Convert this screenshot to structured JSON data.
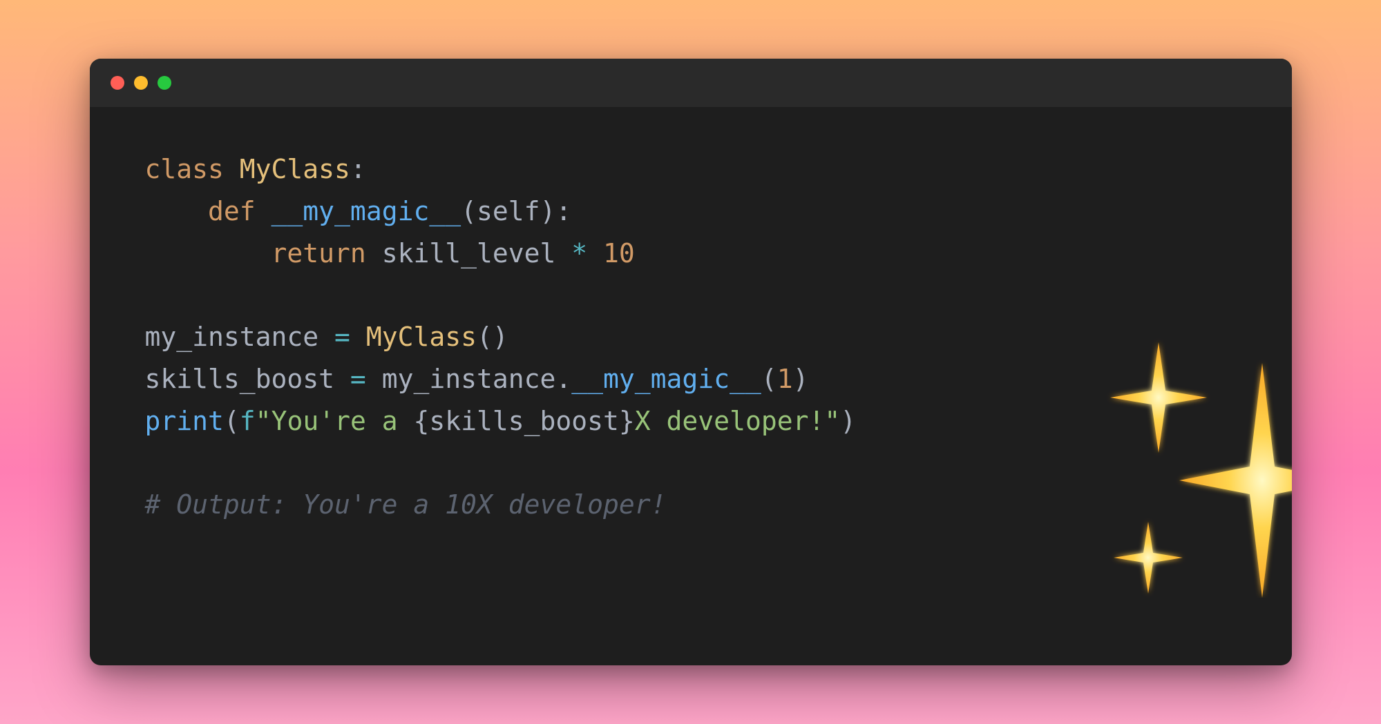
{
  "window": {
    "traffic_lights": [
      "red",
      "yellow",
      "green"
    ]
  },
  "code": {
    "line1": {
      "kw_class": "class",
      "classname": "MyClass",
      "colon": ":"
    },
    "line2": {
      "kw_def": "def",
      "funcname": "__my_magic__",
      "lparen": "(",
      "param_self": "self",
      "rparen_colon": "):"
    },
    "line3": {
      "kw_return": "return",
      "var_skill": "skill_level",
      "op_mul": " * ",
      "num_10": "10"
    },
    "line5": {
      "var_myinst": "my_instance",
      "eq": " = ",
      "cls_call": "MyClass",
      "parens": "()"
    },
    "line6": {
      "var_boost": "skills_boost",
      "eq": " = ",
      "var_inst": "my_instance",
      "dot": ".",
      "method": "__my_magic__",
      "lparen": "(",
      "arg": "1",
      "rparen": ")"
    },
    "line7": {
      "fn_print": "print",
      "lparen": "(",
      "fprefix": "f",
      "str_open": "\"",
      "str_part1": "You're a ",
      "brace_open": "{",
      "interp": "skills_boost",
      "brace_close": "}",
      "str_part2": "X developer!",
      "str_close": "\"",
      "rparen": ")"
    },
    "line9": {
      "comment": "# Output: You're a 10X developer!"
    }
  },
  "decoration": {
    "sparkles_label": "sparkles"
  }
}
